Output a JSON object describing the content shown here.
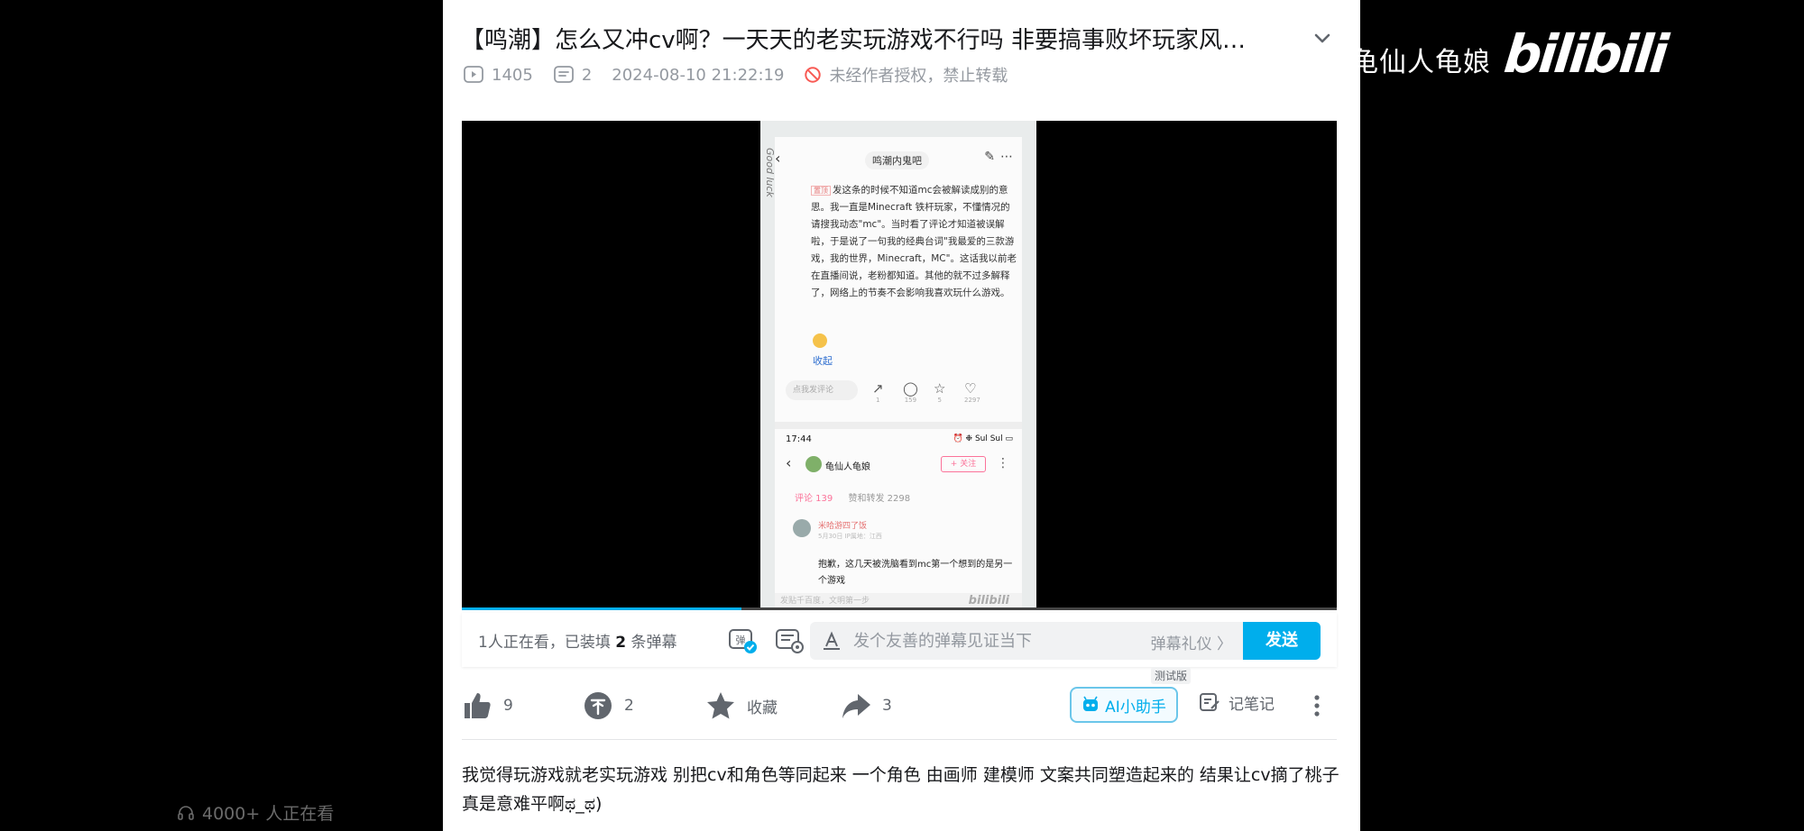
{
  "overlay": {
    "uploader_name": "龟仙人龟娘",
    "logo_text": "bilibili",
    "watching_count": "4000+ 人正在看"
  },
  "video": {
    "title": "【鸣潮】怎么又冲cv啊？一天天的老实玩游戏不行吗 非要搞事败坏玩家风…",
    "views": "1405",
    "danmaku_count": "2",
    "publish_time": "2024-08-10 21:22:19",
    "copyright_notice": "未经作者授权，禁止转载",
    "progress_fraction": 0.32
  },
  "frame": {
    "forum_name": "鸣潮内鬼吧",
    "post_tag": "置顶",
    "post_text": "发这条的时候不知道mc会被解读成别的意思。我一直是Minecraft 铁杆玩家，不懂情况的请搜我动态\"mc\"。当时看了评论才知道被误解啦，于是说了一句我的经典台词\"我最爱的三款游戏，我的世界，Minecraft，MC\"。这话我以前老在直播间说，老粉都知道。其他的就不过多解释了，网络上的节奏不会影响我喜欢玩什么游戏。",
    "fold_label": "收起",
    "reply_placeholder": "点我发评论",
    "counts": [
      "1",
      "159",
      "5",
      "2297"
    ],
    "time": "17:44",
    "status_icons": "⏰ ❉ Sul Sul ▭",
    "user_name": "龟仙人龟娘",
    "follow_label": "+ 关注",
    "tab_comments": "评论 139",
    "tab_likes": "赞和转发 2298",
    "commenter_name": "米哈游四了饭",
    "comment_meta": "5月30日 IP属地：江西",
    "comment_text": "抱歉，这几天被洗脑看到mc第一个想到的是另一个游戏",
    "bottom_input": "发贴千百度，文明第一步",
    "side_text": "Good luck",
    "watermark": "bilibili"
  },
  "danmaku": {
    "info_prefix": "1人正在看，已装填",
    "info_count": "2",
    "info_suffix": "条弹幕",
    "input_placeholder": "发个友善的弹幕见证当下",
    "etiquette": "弹幕礼仪 〉",
    "send_label": "发送"
  },
  "toolbar": {
    "like_count": "9",
    "coin_count": "2",
    "favorite_label": "收藏",
    "share_count": "3",
    "ai_label": "AI小助手",
    "ai_badge": "测试版",
    "note_label": "记笔记"
  },
  "description": "我觉得玩游戏就老实玩游戏 别把cv和角色等同起来 一个角色 由画师 建模师 文案共同塑造起来的 结果让cv摘了桃子 真是意难平啊ಥ_ಥ)"
}
